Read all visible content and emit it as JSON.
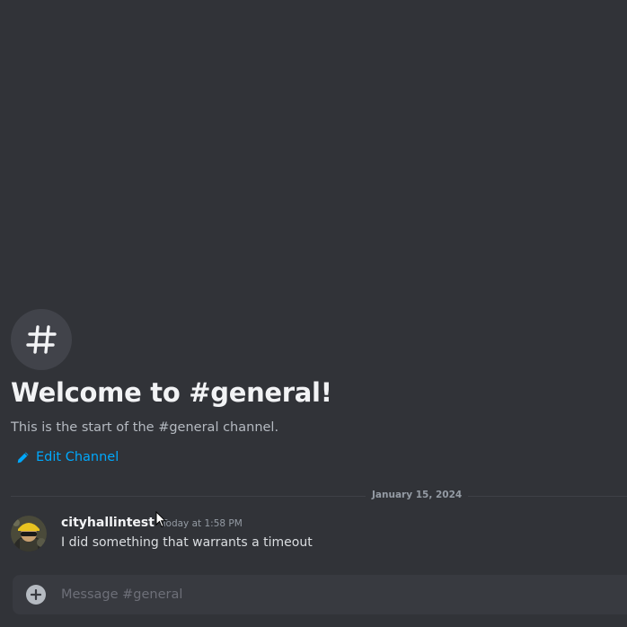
{
  "colors": {
    "background": "#313338",
    "link": "#00a8fc",
    "composer": "#383a40"
  },
  "channel": {
    "icon": "hash-icon",
    "welcome_title": "Welcome to #general!",
    "welcome_subtitle": "This is the start of the #general channel.",
    "edit_channel_label": "Edit Channel",
    "edit_icon": "pencil-icon"
  },
  "divider": {
    "date": "January 15, 2024"
  },
  "messages": [
    {
      "username": "cityhallintest",
      "timestamp": "Today at 1:58 PM",
      "text": "I did something that warrants a timeout"
    }
  ],
  "composer": {
    "placeholder": "Message #general",
    "add_icon": "plus-circle-icon"
  }
}
